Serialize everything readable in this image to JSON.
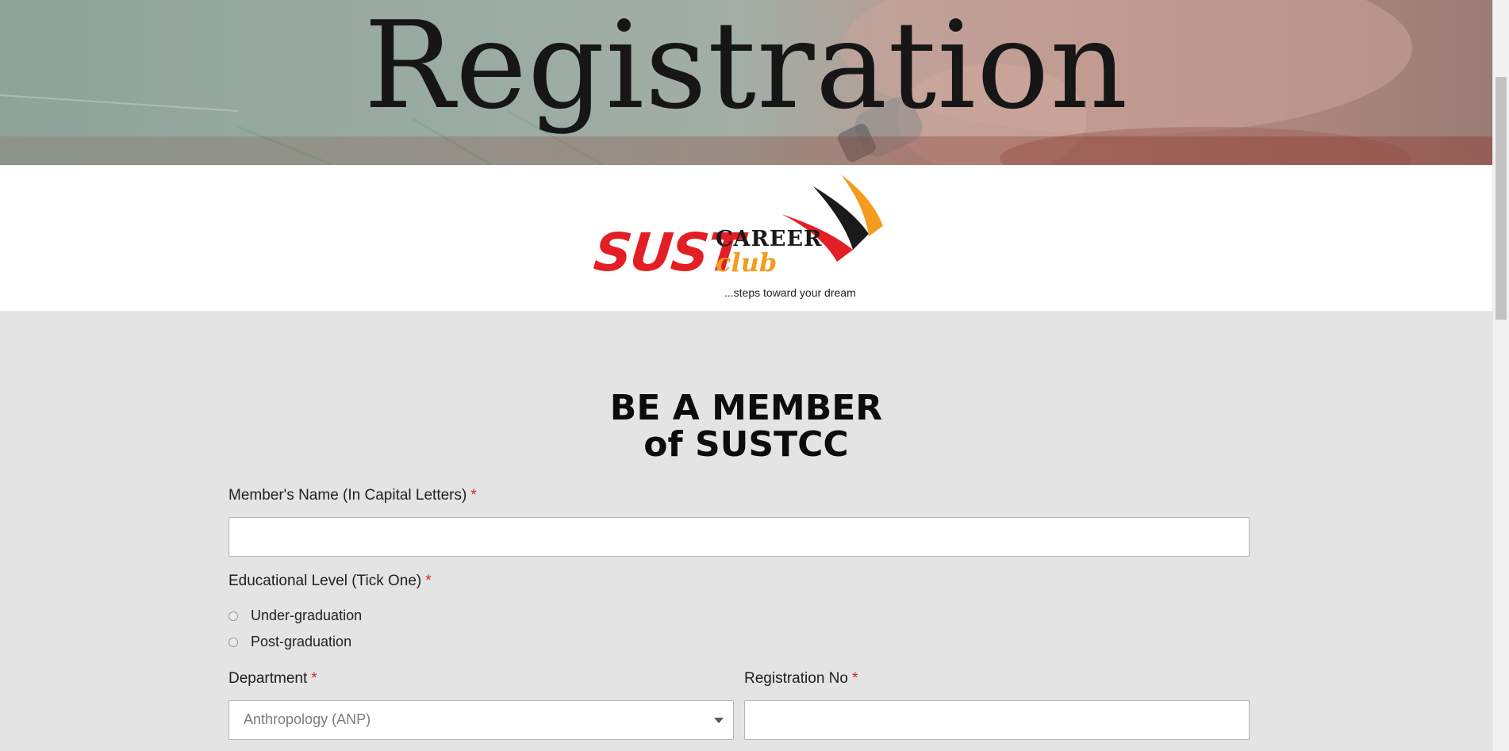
{
  "hero": {
    "title": "Registration"
  },
  "logo": {
    "sust": "SUST",
    "career": "CAREER",
    "club": "club",
    "tagline": "...steps toward your dream",
    "colors": {
      "red": "#e31e24",
      "orange": "#f39c1e",
      "black": "#1a1a1a"
    }
  },
  "form": {
    "title_line1": "BE A MEMBER",
    "title_line2": "of SUSTCC",
    "name": {
      "label": "Member's Name (In Capital Letters)",
      "required_mark": "*",
      "value": ""
    },
    "education": {
      "label": "Educational Level (Tick One)",
      "required_mark": "*",
      "options": [
        "Under-graduation",
        "Post-graduation"
      ]
    },
    "department": {
      "label": "Department",
      "required_mark": "*",
      "selected": "Anthropology (ANP)"
    },
    "registration_no": {
      "label": "Registration No",
      "required_mark": "*",
      "value": ""
    }
  },
  "colors": {
    "page_bg": "#e4e4e4",
    "required": "#e02020"
  }
}
